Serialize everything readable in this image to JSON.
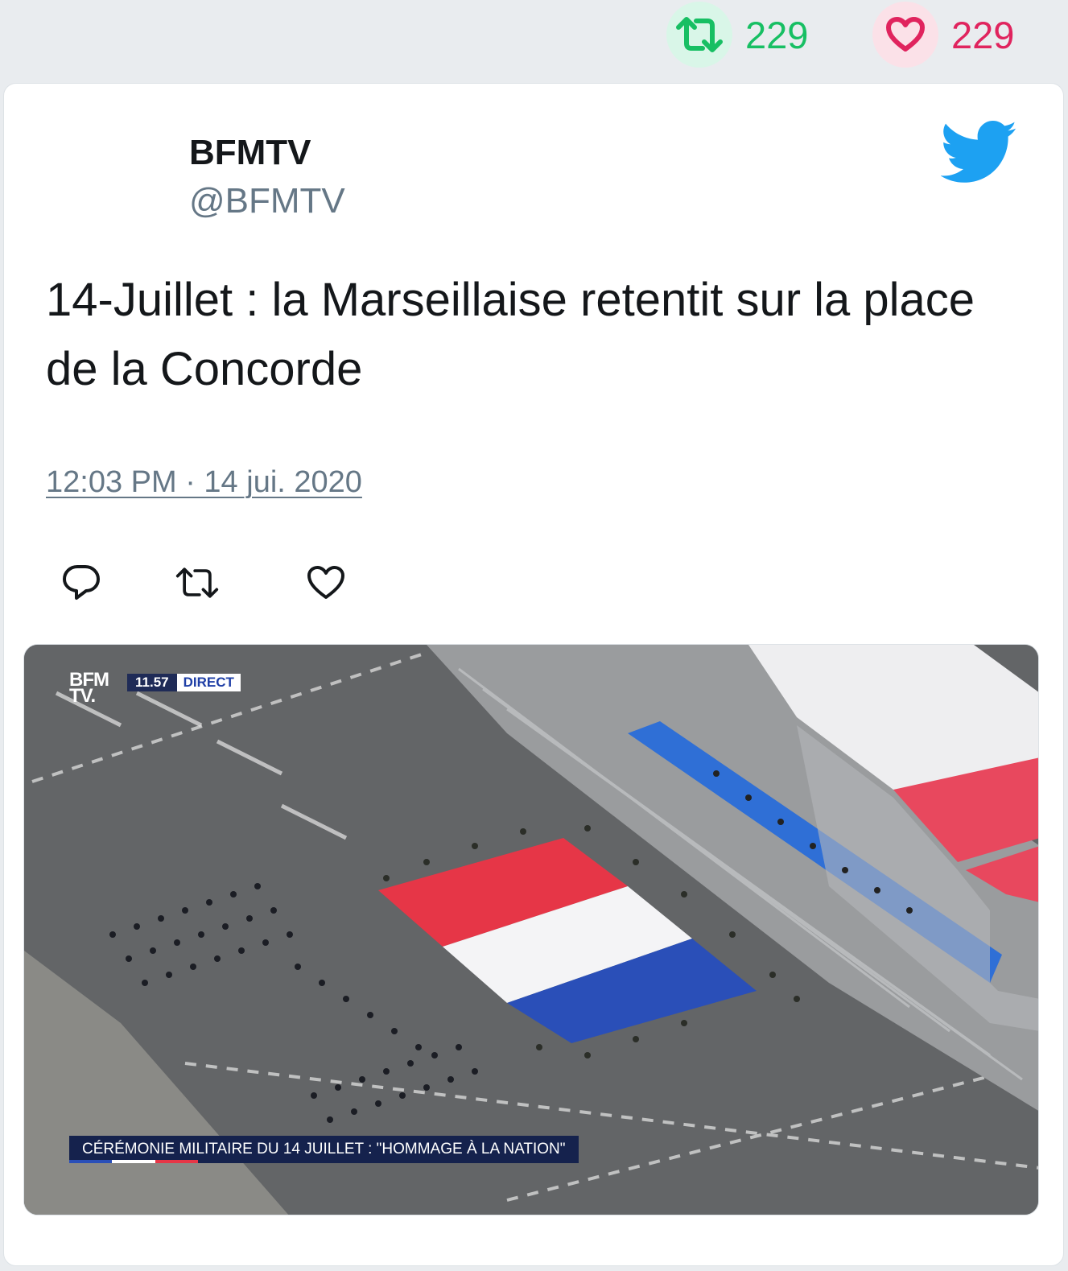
{
  "stats": {
    "retweet_count": "229",
    "like_count": "229"
  },
  "tweet": {
    "author_name": "BFMTV",
    "author_handle": "@BFMTV",
    "text": "14-Juillet : la Marseillaise retentit sur la place de la Concorde",
    "timestamp": "12:03 PM · 14 jui. 2020"
  },
  "media": {
    "logo_line1": "BFM",
    "logo_line2": "TV.",
    "live_time": "11.57",
    "live_label": "DIRECT",
    "banner_text": "CÉRÉMONIE MILITAIRE DU 14 JUILLET : \"HOMMAGE À LA NATION\""
  },
  "colors": {
    "retweet_green": "#17bf63",
    "like_red": "#e0245e",
    "twitter_blue": "#1da1f2",
    "secondary_text": "#657786",
    "flag_blue": "#2a4fb8",
    "flag_white": "#f4f4f6",
    "flag_red": "#e63647"
  },
  "icons": {
    "retweet": "retweet-icon",
    "like": "heart-icon",
    "reply": "reply-icon",
    "brand": "twitter-bird-icon"
  }
}
